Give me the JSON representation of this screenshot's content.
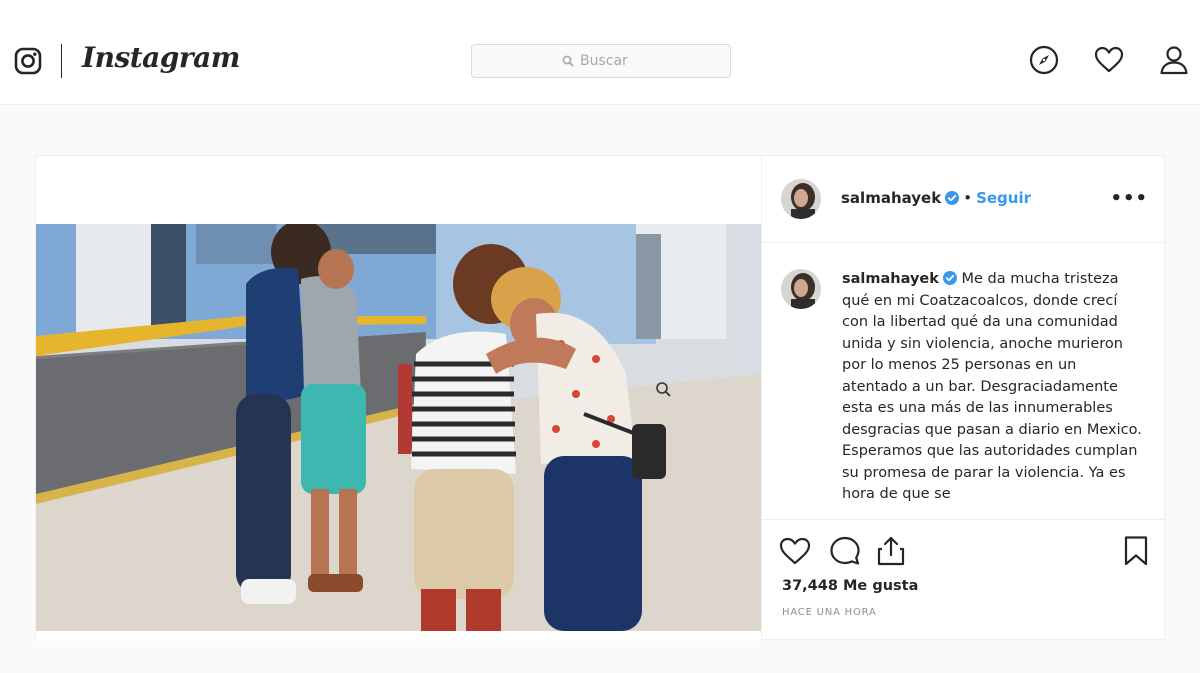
{
  "header": {
    "brand": "Instagram",
    "search_placeholder": "Buscar",
    "icons": [
      "instagram-glyph-icon",
      "compass-icon",
      "heart-icon",
      "profile-icon"
    ]
  },
  "post": {
    "username": "salmahayek",
    "follow_label": "Seguir",
    "separator": "•",
    "more_label": "•••",
    "caption_username": "salmahayek",
    "caption_text": "Me da mucha tristeza qué en mi Coatzacoalcos, donde crecí con la libertad qué da una comunidad unida y sin violencia, anoche murieron por lo menos 25 personas en un atentado a un bar. Desgraciadamente esta es una más de las innumerables desgracias que pasan a diario en Mexico. Esperamos que las autoridades cumplan su promesa de parar la violencia. Ya es hora de que se",
    "likes": "37,448 Me gusta",
    "timestamp": "HACE UNA HORA"
  },
  "colors": {
    "link": "#3897f0",
    "text": "#262626",
    "muted": "#8e8e8e",
    "background": "#fafafa"
  }
}
